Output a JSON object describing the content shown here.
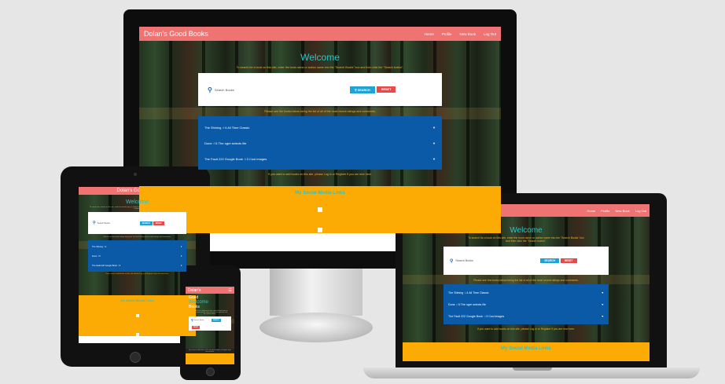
{
  "colors": {
    "nav": "#ef7373",
    "teal": "#2ec4c8",
    "gold": "#f3b12a",
    "blue": "#0a5aa7",
    "orange": "#fcab05",
    "search_btn": "#1fa3d6",
    "reset_btn": "#e84a4a"
  },
  "brand": "Dolan's Good Books",
  "nav_links": [
    "Home",
    "Profile",
    "New Book",
    "Log Out"
  ],
  "welcome": "Welcome",
  "search_instructions": "To search for a book on this site, enter the book name or author name into the \"Search Books\" box and then click the \"Search button\".",
  "search_placeholder": "Search Books",
  "search_label": "SEARCH",
  "reset_label": "RESET",
  "list_instructions": "Please see the books below being the list of all of the most recent ratings and comments.",
  "books": [
    {
      "title": "The Shining",
      "rating": "4",
      "suffix": "All Time Classic"
    },
    {
      "title": "Dune",
      "rating": "5",
      "suffix": "The ogre selects life"
    },
    {
      "title": "The Fault 222 Google Book",
      "rating": "3",
      "suffix": "Cool images"
    }
  ],
  "login_note": "If you want to add books on this site, please Log in or Register if you are new here.",
  "social_title": "My Social Media Links",
  "phone": {
    "brand": "Dolan's",
    "hero_brand": "Good",
    "welcome": "Welcome",
    "books": "Books"
  }
}
